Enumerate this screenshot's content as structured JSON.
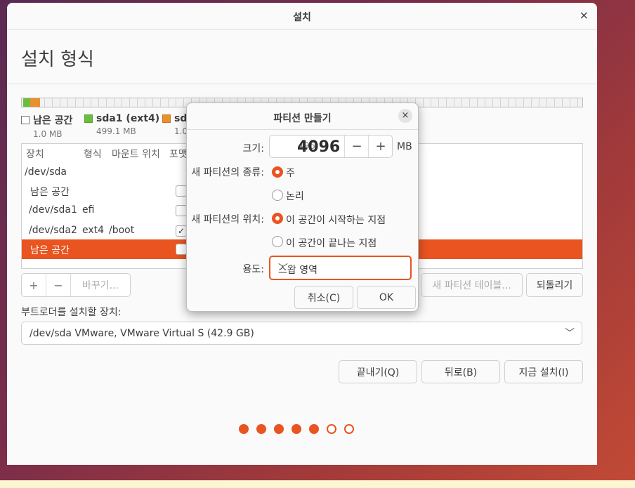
{
  "window": {
    "title": "설치",
    "close_icon": "×"
  },
  "page_title": "설치 형식",
  "legend": [
    {
      "name": "남은 공간",
      "size": "1.0 MB",
      "color": "#ffffff"
    },
    {
      "name": "sda1 (ext4)",
      "size": "499.1 MB",
      "color": "#6cbd3d"
    },
    {
      "name": "sd",
      "size": "1.0",
      "color": "#e8902e"
    }
  ],
  "table": {
    "headers": [
      "장치",
      "형식",
      "마운트 위치",
      "포맷"
    ],
    "rows": [
      {
        "device": "/dev/sda",
        "type": "",
        "mount": "",
        "format": null
      },
      {
        "device": "남은 공간",
        "type": "",
        "mount": "",
        "format": false
      },
      {
        "device": "/dev/sda1",
        "type": "efi",
        "mount": "",
        "format": false
      },
      {
        "device": "/dev/sda2",
        "type": "ext4",
        "mount": "/boot",
        "format": true
      },
      {
        "device": "남은 공간",
        "type": "",
        "mount": "",
        "format": false,
        "selected": true
      }
    ]
  },
  "tools": {
    "add": "+",
    "remove": "−",
    "change": "바꾸기..."
  },
  "new_table_button": "새 파티션 테이블...",
  "revert_button": "되돌리기",
  "bootloader_label": "부트로더를 설치할 장치:",
  "bootloader_value": "/dev/sda   VMware, VMware Virtual S (42.9 GB)",
  "nav": {
    "quit": "끝내기(Q)",
    "back": "뒤로(B)",
    "install": "지금 설치(I)"
  },
  "progress": {
    "total": 7,
    "completed": 5
  },
  "dialog": {
    "title": "파티션 만들기",
    "close_icon": "×",
    "size_label": "크기:",
    "size_value": "4096",
    "size_ghost": "496",
    "size_unit": "MB",
    "minus": "−",
    "plus": "+",
    "type_label": "새 파티션의 종류:",
    "type_primary": "주",
    "type_logical": "논리",
    "location_label": "새 파티션의 위치:",
    "location_start": "이 공간이 시작하는 지점",
    "location_end": "이 공간이 끝나는 지점",
    "use_label": "용도:",
    "use_value": "스왑 영역",
    "cancel": "취소(C)",
    "ok": "OK"
  },
  "colors": {
    "accent": "#e95420"
  }
}
